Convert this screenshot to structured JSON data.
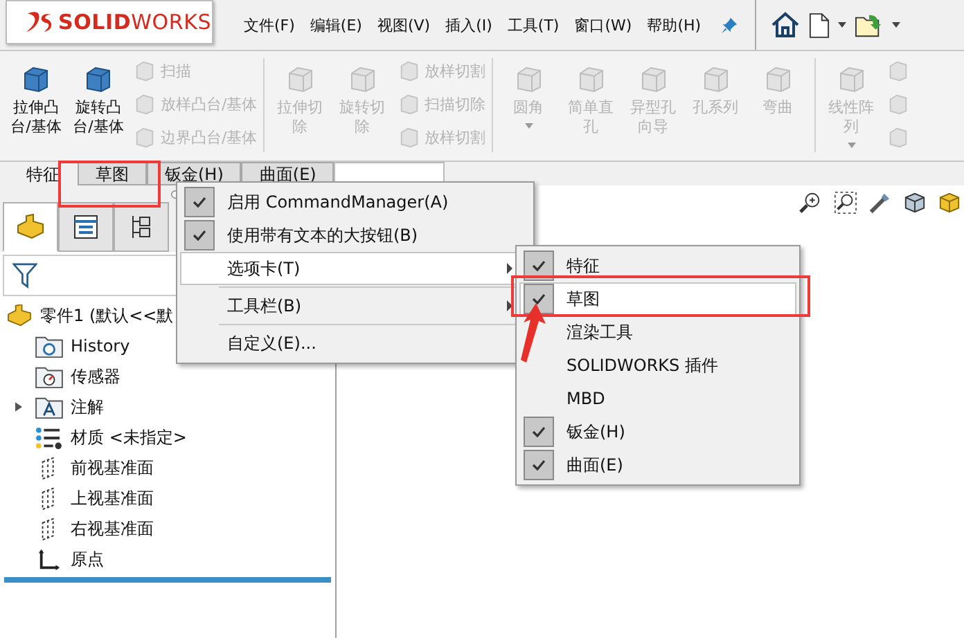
{
  "logo": "**SOLID**WORKS",
  "menu_bar": [
    "文件(F)",
    "编辑(E)",
    "视图(V)",
    "插入(I)",
    "工具(T)",
    "窗口(W)",
    "帮助(H)"
  ],
  "ribbon": [
    {
      "items": [
        {
          "kind": "large",
          "label": "拉伸凸台/基体",
          "disabled": false,
          "dropdown": false
        },
        {
          "kind": "large",
          "label": "旋转凸台/基体",
          "disabled": false,
          "dropdown": false
        },
        {
          "kind": "stack",
          "rows": [
            {
              "label": "扫描",
              "disabled": true
            },
            {
              "label": "放样凸台/基体",
              "disabled": true
            },
            {
              "label": "边界凸台/基体",
              "disabled": true
            }
          ]
        }
      ]
    },
    {
      "items": [
        {
          "kind": "large",
          "label": "拉伸切除",
          "disabled": true,
          "dropdown": false
        },
        {
          "kind": "large",
          "label": "旋转切除",
          "disabled": true,
          "dropdown": false
        },
        {
          "kind": "stack",
          "rows": [
            {
              "label": "放样切割",
              "disabled": true
            },
            {
              "label": "扫描切除",
              "disabled": true
            },
            {
              "label": "放样切割",
              "disabled": true
            }
          ]
        }
      ]
    },
    {
      "items": [
        {
          "kind": "large",
          "label": "圆角",
          "disabled": true,
          "dropdown": true
        },
        {
          "kind": "large",
          "label": "简单直孔",
          "disabled": true,
          "dropdown": false
        },
        {
          "kind": "large",
          "label": "异型孔向导",
          "disabled": true,
          "dropdown": false
        },
        {
          "kind": "large",
          "label": "孔系列",
          "disabled": true,
          "dropdown": false
        },
        {
          "kind": "large",
          "label": "弯曲",
          "disabled": true,
          "dropdown": false
        }
      ]
    },
    {
      "items": [
        {
          "kind": "large",
          "label": "线性阵列",
          "disabled": true,
          "dropdown": true
        },
        {
          "kind": "stack",
          "rows": [
            {
              "disabled": true
            },
            {
              "disabled": true
            },
            {
              "disabled": true
            }
          ]
        }
      ]
    }
  ],
  "tabs": [
    {
      "label": "特征",
      "selected": true
    },
    {
      "label": "草图",
      "selected": false
    },
    {
      "label": "钣金(H)",
      "selected": false
    },
    {
      "label": "曲面(E)",
      "selected": false
    }
  ],
  "panel_tabs": [
    {
      "kind": "features",
      "selected": true
    },
    {
      "kind": "properties",
      "selected": false
    },
    {
      "kind": "configurations",
      "selected": false
    }
  ],
  "tree": {
    "label": "零件1 (默认<<默",
    "kind": "part",
    "children": [
      {
        "label": "History",
        "kind": "history",
        "expandable": false
      },
      {
        "label": "传感器",
        "kind": "sensor",
        "expandable": false
      },
      {
        "label": "注解",
        "kind": "annotation",
        "expandable": true
      },
      {
        "label": "材质 <未指定>",
        "kind": "material",
        "expandable": false
      },
      {
        "label": "前视基准面",
        "kind": "plane",
        "expandable": false
      },
      {
        "label": "上视基准面",
        "kind": "plane",
        "expandable": false
      },
      {
        "label": "右视基准面",
        "kind": "plane",
        "expandable": false
      },
      {
        "label": "原点",
        "kind": "origin",
        "expandable": false
      }
    ]
  },
  "context_menu": [
    {
      "kind": "item",
      "label": "启用 CommandManager(A)",
      "checked": true,
      "submenu": false,
      "selected": false
    },
    {
      "kind": "item",
      "label": "使用带有文本的大按钮(B)",
      "checked": true,
      "submenu": false,
      "selected": false
    },
    {
      "kind": "item",
      "label": "选项卡(T)",
      "checked": false,
      "submenu": true,
      "selected": true
    },
    {
      "kind": "separator"
    },
    {
      "kind": "item",
      "label": "工具栏(B)",
      "checked": false,
      "submenu": true,
      "selected": false
    },
    {
      "kind": "separator"
    },
    {
      "kind": "item",
      "label": "自定义(E)...",
      "checked": false,
      "submenu": false,
      "selected": false
    }
  ],
  "submenu": [
    {
      "label": "特征",
      "checked": true,
      "selected": false
    },
    {
      "label": "草图",
      "checked": true,
      "selected": true
    },
    {
      "label": "渲染工具",
      "checked": false,
      "selected": false
    },
    {
      "label": "SOLIDWORKS 插件",
      "checked": false,
      "selected": false
    },
    {
      "label": "MBD",
      "checked": false,
      "selected": false
    },
    {
      "label": "钣金(H)",
      "checked": true,
      "selected": false
    },
    {
      "label": "曲面(E)",
      "checked": true,
      "selected": false
    }
  ]
}
